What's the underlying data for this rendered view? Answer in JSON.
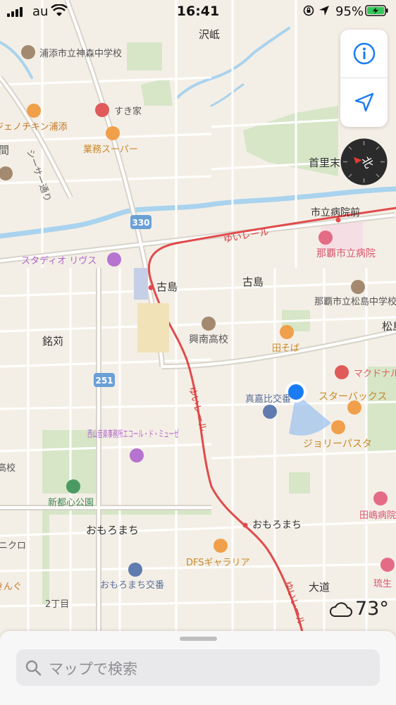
{
  "status_bar": {
    "carrier": "au",
    "time": "16:41",
    "battery_percent": "95%"
  },
  "map": {
    "labels": [
      {
        "id": "sawaju",
        "text": "沢岻",
        "color": "#333333"
      },
      {
        "id": "kamimori-school",
        "text": "浦添市立神森中学校",
        "color": "#555555"
      },
      {
        "id": "sukiya",
        "text": "すき家",
        "color": "#555555"
      },
      {
        "id": "chicken",
        "text": "ジェノチキン浦添",
        "color": "#c27a2a"
      },
      {
        "id": "gyomu",
        "text": "業務スーパー",
        "color": "#c8882a"
      },
      {
        "id": "ma",
        "text": "間",
        "color": "#555555"
      },
      {
        "id": "shisa",
        "text": "シーサー通り",
        "color": "#666666"
      },
      {
        "id": "shuri",
        "text": "首里末吉",
        "color": "#333333"
      },
      {
        "id": "shiritsu-byoin-mae",
        "text": "市立病院前",
        "color": "#333333"
      },
      {
        "id": "yui-rail-1",
        "text": "ゆいレール",
        "color": "#d63a3a"
      },
      {
        "id": "naha-hospital",
        "text": "那覇市立病院",
        "color": "#d9546e"
      },
      {
        "id": "studio",
        "text": "スタディオ リヴス",
        "color": "#b266c8"
      },
      {
        "id": "furujima-station",
        "text": "古島",
        "color": "#333333"
      },
      {
        "id": "furujima",
        "text": "古島",
        "color": "#333333"
      },
      {
        "id": "matsushima-school",
        "text": "那覇市立松島中学校",
        "color": "#555555"
      },
      {
        "id": "matsu",
        "text": "松島",
        "color": "#333333"
      },
      {
        "id": "konan",
        "text": "興南高校",
        "color": "#555555"
      },
      {
        "id": "tasoba",
        "text": "田そば",
        "color": "#c8882a"
      },
      {
        "id": "meikari",
        "text": "銘苅",
        "color": "#333333"
      },
      {
        "id": "mcdonalds",
        "text": "マクドナルド",
        "color": "#e06060"
      },
      {
        "id": "makabi",
        "text": "真嘉比交番",
        "color": "#5b6f9c"
      },
      {
        "id": "starbucks",
        "text": "スターバックス",
        "color": "#c8882a"
      },
      {
        "id": "yui-rail-2",
        "text": "ゆいレール",
        "color": "#d63a3a"
      },
      {
        "id": "route-251",
        "text": "251",
        "color": "#ffffff"
      },
      {
        "id": "route-330",
        "text": "330",
        "color": "#ffffff"
      },
      {
        "id": "nishiyama",
        "text": "西山音楽事務所エコール・ド・ミューゼ",
        "color": "#b266c8"
      },
      {
        "id": "jolly",
        "text": "ジョリーパスタ",
        "color": "#c8882a"
      },
      {
        "id": "koko",
        "text": "高校",
        "color": "#555555"
      },
      {
        "id": "park",
        "text": "新都心公園",
        "color": "#3f8a55"
      },
      {
        "id": "tagema",
        "text": "田嶋病院",
        "color": "#d9546e"
      },
      {
        "id": "omoromachi-area",
        "text": "おもろまち",
        "color": "#333333"
      },
      {
        "id": "omoromachi-station",
        "text": "おもろまち",
        "color": "#333333"
      },
      {
        "id": "nikuro",
        "text": "ニクロ",
        "color": "#555555"
      },
      {
        "id": "dfs",
        "text": "DFSギャラリア",
        "color": "#c8882a"
      },
      {
        "id": "kingu",
        "text": "きんぐ",
        "color": "#c27a2a"
      },
      {
        "id": "omoromachi-koban",
        "text": "おもろまち交番",
        "color": "#5b6f9c"
      },
      {
        "id": "oomichi",
        "text": "大道",
        "color": "#333333"
      },
      {
        "id": "ryusei",
        "text": "琉生",
        "color": "#d9546e"
      },
      {
        "id": "nichome",
        "text": "2丁目",
        "color": "#555555"
      },
      {
        "id": "yui-rail-3",
        "text": "ゆいレール",
        "color": "#d63a3a"
      }
    ]
  },
  "controls": {
    "info_icon": "info-icon",
    "location_icon": "location-arrow-icon",
    "compass_label": "北"
  },
  "weather": {
    "icon": "cloud-icon",
    "temperature": "73°"
  },
  "search": {
    "placeholder": "マップで検索"
  },
  "colors": {
    "land": "#f4efe6",
    "water": "#a9d3ee",
    "green": "#cfe3c0",
    "rail": "#e04b4b",
    "accent_blue": "#1a7cf5"
  }
}
